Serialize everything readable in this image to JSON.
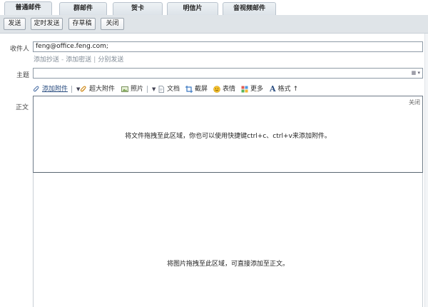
{
  "tabs": [
    {
      "label": "普通邮件",
      "active": true
    },
    {
      "label": "群邮件",
      "active": false
    },
    {
      "label": "贺卡",
      "active": false
    },
    {
      "label": "明信片",
      "active": false
    },
    {
      "label": "音视频邮件",
      "active": false
    }
  ],
  "toolbar": {
    "send": "发送",
    "scheduled_send": "定时发送",
    "save_draft": "存草稿",
    "close": "关闭"
  },
  "form": {
    "to_label": "收件人",
    "to_value": "feng@office.feng.com;",
    "links": [
      "添加抄送",
      "添加密送",
      "分别发送"
    ],
    "link_sep_1": "-",
    "link_sep_2": "|",
    "subject_label": "主题",
    "subject_value": "",
    "subject_tool": "▦ ▾",
    "body_label": "正文"
  },
  "editor_toolbar": {
    "attach": "添加附件",
    "big_attach": "超大附件",
    "photo": "照片",
    "doc": "文档",
    "screenshot": "截屏",
    "emoji": "表情",
    "more": "更多",
    "format": "格式",
    "format_suffix": "↑",
    "dropdown": "▼"
  },
  "drop_zone": {
    "close": "关闭",
    "attach_message": "将文件拖拽至此区域，你也可以使用快捷键ctrl+c、ctrl+v来添加附件。",
    "image_message": "将图片拖拽至此区域，可直接添加至正文。"
  },
  "colors": {
    "toolbar_bg": "#dfe4e8",
    "tab_bg": "#e6ebef",
    "link": "#2a4d80"
  }
}
